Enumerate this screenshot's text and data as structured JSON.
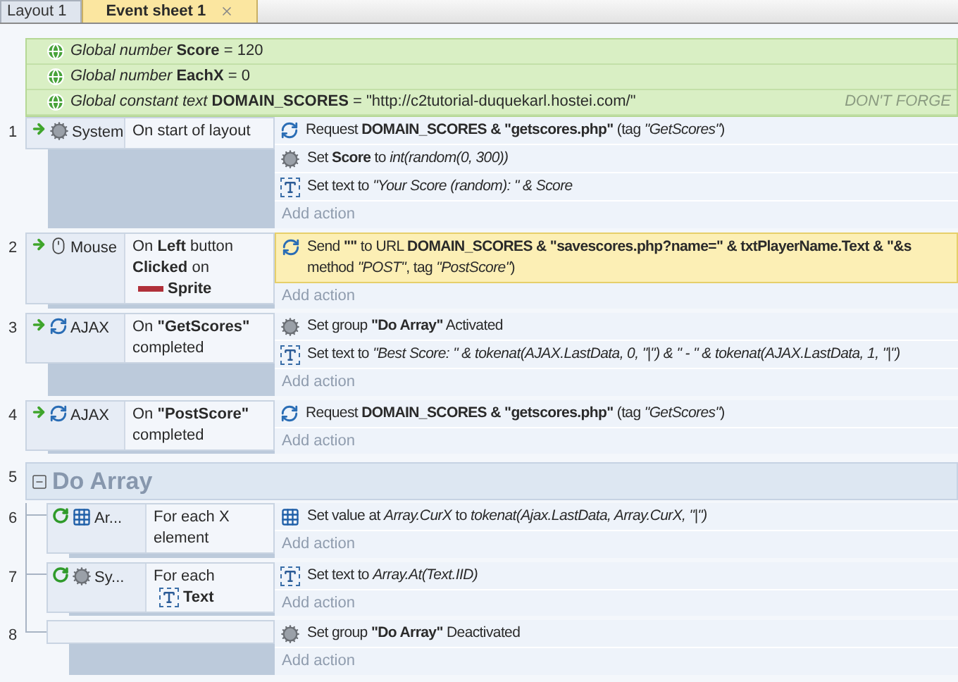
{
  "tabs": [
    {
      "label": "Layout 1",
      "selected": false,
      "closable": false
    },
    {
      "label": "Event sheet 1",
      "selected": true,
      "closable": true
    }
  ],
  "globals": [
    {
      "text": "*Global number* **Score** = 120"
    },
    {
      "text": "*Global number* **EachX** = 0"
    },
    {
      "text": "*Global constant text* **DOMAIN_SCORES** = \"http://c2tutorial-duquekarl.hostei.com/\"",
      "comment": "DON'T FORGE"
    }
  ],
  "events": [
    {
      "kind": "event",
      "number": "1",
      "condition": {
        "kind": "trigger",
        "object": {
          "kind": "system",
          "name": "System"
        },
        "text": "On start of layout"
      },
      "actions": [
        {
          "kind": "ajax",
          "selected": false,
          "lines": [
            "Request **DOMAIN_SCORES & \"getscores.php\"** (tag *\"GetScores\"*)"
          ]
        },
        {
          "kind": "system",
          "selected": false,
          "lines": [
            "Set **Score** to *int(random(0, 300))*"
          ]
        },
        {
          "kind": "text",
          "selected": false,
          "lines": [
            "Set text to *\"Your Score (random): \" & Score*"
          ]
        }
      ],
      "add_action": "Add action"
    },
    {
      "kind": "event",
      "number": "2",
      "condition": {
        "kind": "trigger",
        "object": {
          "kind": "mouse",
          "name": "Mouse"
        },
        "text": "On **Left** button **Clicked** on",
        "param": {
          "kind": "sprite",
          "name": "Sprite"
        }
      },
      "actions": [
        {
          "kind": "ajax",
          "selected": true,
          "lines": [
            "Send **\"\"** to URL **DOMAIN_SCORES & \"savescores.php?name=\" & txtPlayerName.Text & \"&s**",
            "method *\"POST\"*, tag *\"PostScore\"*)"
          ]
        }
      ],
      "add_action": "Add action"
    },
    {
      "kind": "event",
      "number": "3",
      "condition": {
        "kind": "trigger",
        "object": {
          "kind": "ajax",
          "name": "AJAX"
        },
        "text": "On **\"GetScores\"** completed"
      },
      "actions": [
        {
          "kind": "system",
          "selected": false,
          "lines": [
            "Set group **\"Do Array\"** Activated"
          ]
        },
        {
          "kind": "text",
          "selected": false,
          "lines": [
            "Set text to *\"Best Score: \" & tokenat(AJAX.LastData, 0, \"|\") & \" - \" & tokenat(AJAX.LastData, 1, \"|\")*"
          ]
        }
      ],
      "add_action": "Add action"
    },
    {
      "kind": "event",
      "number": "4",
      "condition": {
        "kind": "trigger",
        "object": {
          "kind": "ajax",
          "name": "AJAX"
        },
        "text": "On **\"PostScore\"** completed"
      },
      "actions": [
        {
          "kind": "ajax",
          "selected": false,
          "lines": [
            "Request **DOMAIN_SCORES & \"getscores.php\"** (tag *\"GetScores\"*)"
          ]
        }
      ],
      "add_action": "Add action"
    },
    {
      "kind": "group",
      "number": "5",
      "title": "Do Array",
      "expanded": true,
      "children": [
        {
          "kind": "event",
          "number": "6",
          "condition": {
            "kind": "loop",
            "object": {
              "kind": "array",
              "name": "Ar..."
            },
            "text": "For each X element"
          },
          "actions": [
            {
              "kind": "array",
              "selected": false,
              "lines": [
                "Set value at *Array.CurX* to *tokenat(Ajax.LastData, Array.CurX, \"|\")*"
              ]
            }
          ],
          "add_action": "Add action"
        },
        {
          "kind": "event",
          "number": "7",
          "condition": {
            "kind": "loop",
            "object": {
              "kind": "system",
              "name": "Sy..."
            },
            "text": "For each",
            "param": {
              "kind": "text",
              "name": "Text"
            }
          },
          "actions": [
            {
              "kind": "text",
              "selected": false,
              "lines": [
                "Set text to *Array.At(Text.IID)*"
              ]
            }
          ],
          "add_action": "Add action"
        },
        {
          "kind": "event",
          "number": "8",
          "actions": [
            {
              "kind": "system",
              "selected": false,
              "lines": [
                "Set group **\"Do Array\"** Deactivated"
              ]
            }
          ],
          "add_action": "Add action"
        }
      ]
    }
  ]
}
